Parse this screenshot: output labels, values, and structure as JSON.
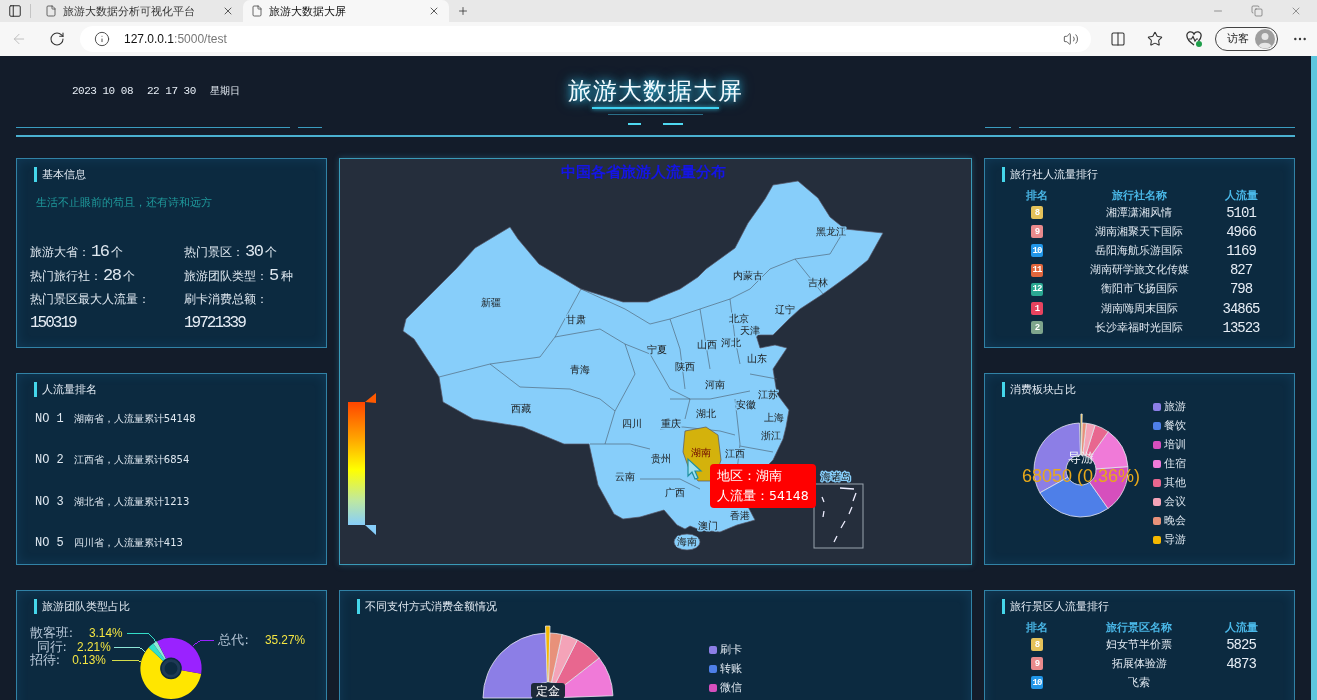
{
  "browser": {
    "tabs": [
      {
        "title": "旅游大数据分析可视化平台",
        "selected": false
      },
      {
        "title": "旅游大数据大屏",
        "selected": true
      }
    ],
    "url": {
      "host": "127.0.0.1",
      "path": ":5000/test"
    },
    "profile": "访客"
  },
  "header": {
    "date": "2023 10 08",
    "time": "22 17 30",
    "weekday": "星期日",
    "title": "旅游大数据大屏"
  },
  "basic_info": {
    "title": "基本信息",
    "motto": "生活不止眼前的苟且，还有诗和远方",
    "stats": [
      {
        "label": "旅游大省：",
        "value": "16",
        "unit": "个"
      },
      {
        "label": "热门景区：",
        "value": "30",
        "unit": "个"
      },
      {
        "label": "热门旅行社：",
        "value": "28",
        "unit": "个"
      },
      {
        "label": "旅游团队类型：",
        "value": "5",
        "unit": "种"
      }
    ],
    "totals": [
      {
        "label": "热门景区最大人流量：",
        "value": "150319"
      },
      {
        "label": "刷卡消费总额：",
        "value": "19721339"
      }
    ]
  },
  "map": {
    "title": "中国各省旅游人流量分布",
    "regions": [
      {
        "name": "黑龙江",
        "highlighted": false
      },
      {
        "name": "内蒙古",
        "highlighted": false
      },
      {
        "name": "吉林",
        "highlighted": false
      },
      {
        "name": "新疆",
        "highlighted": false
      },
      {
        "name": "辽宁",
        "highlighted": false
      },
      {
        "name": "甘肃",
        "highlighted": false
      },
      {
        "name": "北京",
        "highlighted": false
      },
      {
        "name": "天津",
        "highlighted": false
      },
      {
        "name": "宁夏",
        "highlighted": false
      },
      {
        "name": "山西",
        "highlighted": false
      },
      {
        "name": "河北",
        "highlighted": false
      },
      {
        "name": "山东",
        "highlighted": false
      },
      {
        "name": "青海",
        "highlighted": false
      },
      {
        "name": "陕西",
        "highlighted": false
      },
      {
        "name": "河南",
        "highlighted": false
      },
      {
        "name": "江苏",
        "highlighted": false
      },
      {
        "name": "西藏",
        "highlighted": false
      },
      {
        "name": "安徽",
        "highlighted": false
      },
      {
        "name": "湖北",
        "highlighted": false
      },
      {
        "name": "上海",
        "highlighted": false
      },
      {
        "name": "四川",
        "highlighted": false
      },
      {
        "name": "重庆",
        "highlighted": false
      },
      {
        "name": "浙江",
        "highlighted": false
      },
      {
        "name": "贵州",
        "highlighted": false
      },
      {
        "name": "湖南",
        "highlighted": true
      },
      {
        "name": "江西",
        "highlighted": false
      },
      {
        "name": "云南",
        "highlighted": false
      },
      {
        "name": "海诸岛",
        "highlighted": false
      },
      {
        "name": "广西",
        "highlighted": false
      },
      {
        "name": "香港",
        "highlighted": false
      },
      {
        "name": "澳门",
        "highlighted": false
      },
      {
        "name": "海南",
        "highlighted": false
      }
    ],
    "tooltip": [
      "地区：湖南",
      "人流量：54148"
    ]
  },
  "agency_ranking": {
    "title": "旅行社人流量排行",
    "columns": [
      "排名",
      "旅行社名称",
      "人流量"
    ],
    "rows": [
      {
        "rank": "8",
        "color": "#e5c25a",
        "name": "湘潭潇湘风情",
        "flow": "5101"
      },
      {
        "rank": "9",
        "color": "#e98a8c",
        "name": "湖南湘聚天下国际",
        "flow": "4966"
      },
      {
        "rank": "10",
        "color": "#2196e8",
        "name": "岳阳海航乐游国际",
        "flow": "1169"
      },
      {
        "rank": "11",
        "color": "#e0663c",
        "name": "湖南研学旅文化传媒",
        "flow": "827"
      },
      {
        "rank": "12",
        "color": "#2aa892",
        "name": "衡阳市飞扬国际",
        "flow": "798"
      },
      {
        "rank": "1",
        "color": "#e8435f",
        "name": "湖南嗨周末国际",
        "flow": "34865"
      },
      {
        "rank": "2",
        "color": "#7ea58c",
        "name": "长沙幸福时光国际",
        "flow": "13523"
      }
    ]
  },
  "flow_ranking": {
    "title": "人流量排名",
    "items": [
      {
        "rank": "NO 1",
        "text": "湖南省，人流量累计54148"
      },
      {
        "rank": "NO 2",
        "text": "江西省，人流量累计6854"
      },
      {
        "rank": "NO 3",
        "text": "湖北省，人流量累计1213"
      },
      {
        "rank": "NO 5",
        "text": "四川省，人流量累计413"
      }
    ]
  },
  "consumption": {
    "title": "消费板块占比",
    "legend": [
      {
        "name": "旅游",
        "color": "#8c7ee6"
      },
      {
        "name": "餐饮",
        "color": "#4e7fe8"
      },
      {
        "name": "培训",
        "color": "#d64fbd"
      },
      {
        "name": "住宿",
        "color": "#f07ad8"
      },
      {
        "name": "其他",
        "color": "#e8678f"
      },
      {
        "name": "会议",
        "color": "#f4a3b8"
      },
      {
        "name": "晚会",
        "color": "#e8917a"
      },
      {
        "name": "导游",
        "color": "#f5b800"
      }
    ],
    "slices": [
      {
        "highlighted": false
      },
      {
        "highlighted": false
      },
      {
        "highlighted": false
      },
      {
        "highlighted": false
      },
      {
        "highlighted": false
      },
      {
        "highlighted": false
      },
      {
        "highlighted": false
      },
      {
        "highlighted": true
      }
    ],
    "emphasis": {
      "name": "导游",
      "value": "68050 (0.36%)"
    }
  },
  "team_types": {
    "title": "旅游团队类型占比",
    "labels": [
      {
        "name": "散客班:",
        "value": "3.14%",
        "color": "#34e0c8"
      },
      {
        "name": "同行:",
        "value": "2.21%",
        "color": "#8fe8d8"
      },
      {
        "name": "招待:",
        "value": "0.13%",
        "color": "#d8e04c"
      },
      {
        "name": "总代:",
        "value": "35.27%",
        "color": "#9a22ff"
      }
    ]
  },
  "payment": {
    "title": "不同支付方式消费金额情况",
    "legend": [
      {
        "name": "刷卡",
        "color": "#8c7ee6"
      },
      {
        "name": "转账",
        "color": "#4e7fe8"
      },
      {
        "name": "微信",
        "color": "#d64fbd"
      }
    ],
    "center_label": "定金"
  },
  "scenic_ranking": {
    "title": "旅行景区人流量排行",
    "columns": [
      "排名",
      "旅行景区名称",
      "人流量"
    ],
    "rows": [
      {
        "rank": "8",
        "color": "#e5c25a",
        "name": "妇女节半价票",
        "flow": "5825"
      },
      {
        "rank": "9",
        "color": "#e98a8c",
        "name": "拓展体验游",
        "flow": "4873"
      },
      {
        "rank": "10",
        "color": "#2196e8",
        "name": "飞索"
      }
    ]
  }
}
